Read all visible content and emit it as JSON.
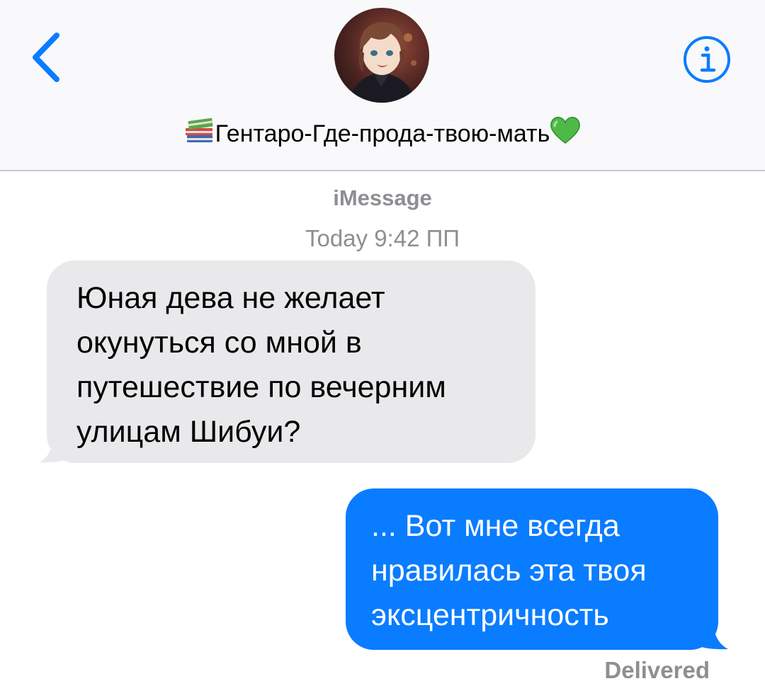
{
  "header": {
    "contact_name": "Гентаро-Где-прода-твою-мать",
    "prefix_emoji": "books-emoji",
    "suffix_emoji": "green-heart-emoji",
    "back_icon": "chevron-left-icon",
    "info_icon": "info-circle-icon",
    "accent_color": "#0a7cff"
  },
  "thread": {
    "service": "iMessage",
    "timestamp": "Today 9:42 ПП"
  },
  "messages": [
    {
      "direction": "incoming",
      "text": "Юная дева не желает\nокунуться со мной в\nпутешествие по вечерним\nулицам Шибуи?",
      "bubble_color": "#e9e9eb"
    },
    {
      "direction": "outgoing",
      "text": "... Вот мне всегда\nнравилась эта твоя\nэксцентричность",
      "bubble_color": "#0a7cff"
    }
  ],
  "delivery_status": "Delivered"
}
